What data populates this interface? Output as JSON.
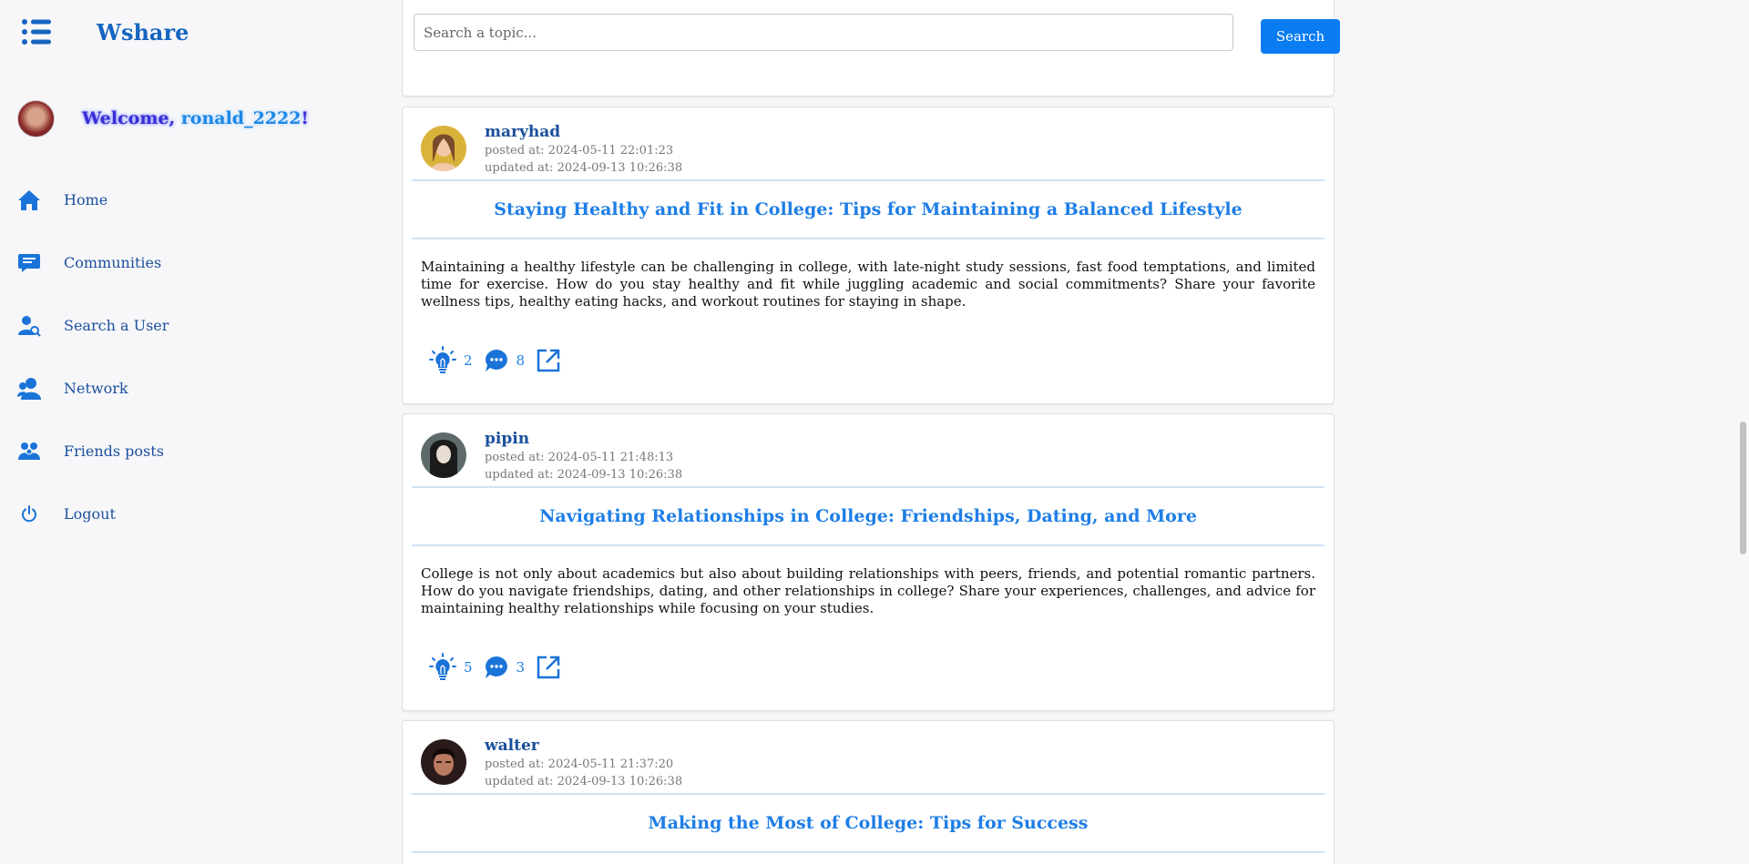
{
  "app": {
    "brand": "Wshare"
  },
  "user": {
    "welcome_prefix": "Welcome, ",
    "username": "ronald_2222",
    "welcome_suffix": "!"
  },
  "search": {
    "placeholder": "Search a topic...",
    "button": "Search"
  },
  "nav": [
    {
      "label": "Home",
      "icon": "home-icon"
    },
    {
      "label": "Communities",
      "icon": "chat-icon"
    },
    {
      "label": "Search a User",
      "icon": "user-search-icon"
    },
    {
      "label": "Network",
      "icon": "network-icon"
    },
    {
      "label": "Friends posts",
      "icon": "friends-icon"
    },
    {
      "label": "Logout",
      "icon": "power-icon"
    }
  ],
  "colors": {
    "accent": "#0a7cf2",
    "title": "#1e7ee6",
    "link": "#1a4f9c",
    "rule": "#cfe2f3"
  },
  "posts": [
    {
      "author": "maryhad",
      "posted": "posted at: 2024-05-11 22:01:23",
      "updated": "updated at: 2024-09-13 10:26:38",
      "title": "Staying Healthy and Fit in College: Tips for Maintaining a Balanced Lifestyle",
      "body": "Maintaining a healthy lifestyle can be challenging in college, with late-night study sessions, fast food temptations, and limited time for exercise. How do you stay healthy and fit while juggling academic and social commitments? Share your favorite wellness tips, healthy eating hacks, and workout routines for staying in shape.",
      "ideas": "2",
      "comments": "8"
    },
    {
      "author": "pipin",
      "posted": "posted at: 2024-05-11 21:48:13",
      "updated": "updated at: 2024-09-13 10:26:38",
      "title": "Navigating Relationships in College: Friendships, Dating, and More",
      "body": "College is not only about academics but also about building relationships with peers, friends, and potential romantic partners. How do you navigate friendships, dating, and other relationships in college? Share your experiences, challenges, and advice for maintaining healthy relationships while focusing on your studies.",
      "ideas": "5",
      "comments": "3"
    },
    {
      "author": "walter",
      "posted": "posted at: 2024-05-11 21:37:20",
      "updated": "updated at: 2024-09-13 10:26:38",
      "title": "Making the Most of College: Tips for Success"
    }
  ]
}
